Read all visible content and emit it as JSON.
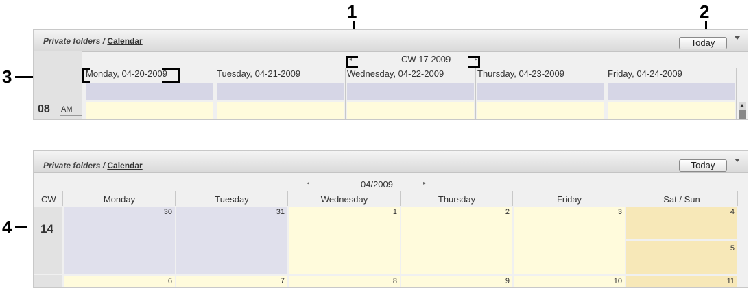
{
  "callouts": {
    "one": "1",
    "two": "2",
    "three": "3",
    "four": "4"
  },
  "week_view": {
    "breadcrumb_prefix": "Private folders / ",
    "breadcrumb_link": "Calendar",
    "today_button": "Today",
    "nav_label": "CW 17 2009",
    "days": [
      "Monday, 04-20-2009",
      "Tuesday, 04-21-2009",
      "Wednesday, 04-22-2009",
      "Thursday, 04-23-2009",
      "Friday, 04-24-2009"
    ],
    "hour": "08",
    "ampm": "AM"
  },
  "month_view": {
    "breadcrumb_prefix": "Private folders / ",
    "breadcrumb_link": "Calendar",
    "today_button": "Today",
    "nav_label": "04/2009",
    "cw_header": "CW",
    "weekdays": [
      "Monday",
      "Tuesday",
      "Wednesday",
      "Thursday",
      "Friday",
      "Sat / Sun"
    ],
    "week_number": "14",
    "row1_dates": [
      "30",
      "31",
      "1",
      "2",
      "3",
      "4",
      "5"
    ],
    "row2_dates": [
      "6",
      "7",
      "8",
      "9",
      "10",
      "11"
    ]
  },
  "colors": {
    "prev_month": "#e0e0ec",
    "current": "#fffbdc",
    "weekend": "#f7e8b8",
    "allday": "#d6d6e6"
  }
}
